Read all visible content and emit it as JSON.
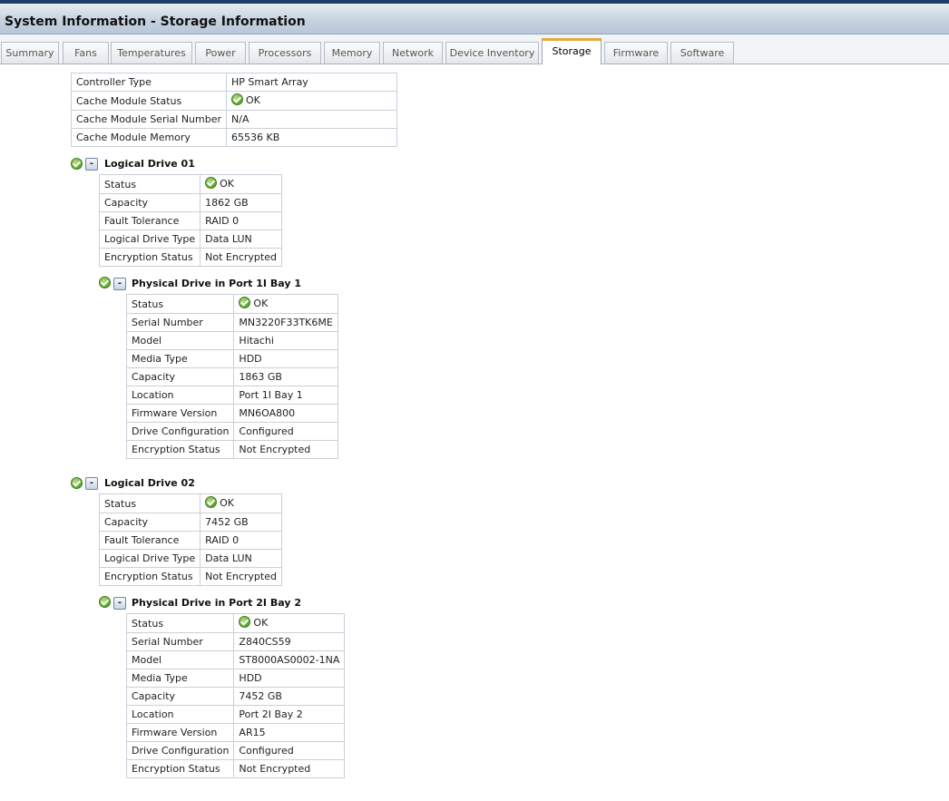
{
  "title": "System Information - Storage Information",
  "tabs": [
    {
      "label": "Summary"
    },
    {
      "label": "Fans"
    },
    {
      "label": "Temperatures"
    },
    {
      "label": "Power"
    },
    {
      "label": "Processors"
    },
    {
      "label": "Memory"
    },
    {
      "label": "Network"
    },
    {
      "label": "Device Inventory"
    },
    {
      "label": "Storage",
      "active": true
    },
    {
      "label": "Firmware"
    },
    {
      "label": "Software"
    }
  ],
  "controller": {
    "rows": [
      {
        "label": "Controller Type",
        "value": "HP Smart Array"
      },
      {
        "label": "Cache Module Status",
        "value": "OK"
      },
      {
        "label": "Cache Module Serial Number",
        "value": "N/A"
      },
      {
        "label": "Cache Module Memory",
        "value": "65536 KB"
      }
    ]
  },
  "logical_drives": [
    {
      "title": "Logical Drive 01",
      "toggle": "-",
      "rows": [
        {
          "label": "Status",
          "value": "OK"
        },
        {
          "label": "Capacity",
          "value": "1862 GB"
        },
        {
          "label": "Fault Tolerance",
          "value": "RAID 0"
        },
        {
          "label": "Logical Drive Type",
          "value": "Data LUN"
        },
        {
          "label": "Encryption Status",
          "value": "Not Encrypted"
        }
      ],
      "physical": {
        "title": "Physical Drive in Port 1I Bay 1",
        "toggle": "-",
        "rows": [
          {
            "label": "Status",
            "value": "OK"
          },
          {
            "label": "Serial Number",
            "value": "MN3220F33TK6ME"
          },
          {
            "label": "Model",
            "value": "Hitachi"
          },
          {
            "label": "Media Type",
            "value": "HDD"
          },
          {
            "label": "Capacity",
            "value": "1863 GB"
          },
          {
            "label": "Location",
            "value": "Port 1I Bay 1"
          },
          {
            "label": "Firmware Version",
            "value": "MN6OA800"
          },
          {
            "label": "Drive Configuration",
            "value": "Configured"
          },
          {
            "label": "Encryption Status",
            "value": "Not Encrypted"
          }
        ]
      }
    },
    {
      "title": "Logical Drive 02",
      "toggle": "-",
      "rows": [
        {
          "label": "Status",
          "value": "OK"
        },
        {
          "label": "Capacity",
          "value": "7452 GB"
        },
        {
          "label": "Fault Tolerance",
          "value": "RAID 0"
        },
        {
          "label": "Logical Drive Type",
          "value": "Data LUN"
        },
        {
          "label": "Encryption Status",
          "value": "Not Encrypted"
        }
      ],
      "physical": {
        "title": "Physical Drive in Port 2I Bay 2",
        "toggle": "-",
        "rows": [
          {
            "label": "Status",
            "value": "OK"
          },
          {
            "label": "Serial Number",
            "value": "Z840CS59"
          },
          {
            "label": "Model",
            "value": "ST8000AS0002-1NA"
          },
          {
            "label": "Media Type",
            "value": "HDD"
          },
          {
            "label": "Capacity",
            "value": "7452 GB"
          },
          {
            "label": "Location",
            "value": "Port 2I Bay 2"
          },
          {
            "label": "Firmware Version",
            "value": "AR15"
          },
          {
            "label": "Drive Configuration",
            "value": "Configured"
          },
          {
            "label": "Encryption Status",
            "value": "Not Encrypted"
          }
        ]
      }
    }
  ],
  "icons": {
    "status_ok": "check-circle-icon",
    "collapse": "collapse-toggle-icon"
  },
  "colors": {
    "header_bar": "#1f3e68",
    "active_tab_accent": "#e5a93b",
    "ok_green": "#6cb33a"
  }
}
